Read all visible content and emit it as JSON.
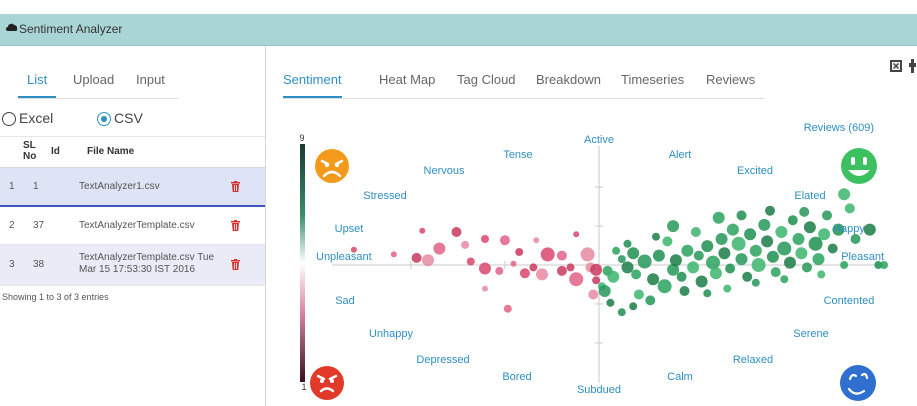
{
  "app": {
    "title": "Sentiment Analyzer"
  },
  "left_tabs": [
    "List",
    "Upload",
    "Input"
  ],
  "file_types": {
    "excel": "Excel",
    "csv": "CSV",
    "selected": "CSV"
  },
  "table": {
    "headers": {
      "sl": "SL No",
      "id": "Id",
      "file": "File Name"
    },
    "rows": [
      {
        "sl": "1",
        "id": "1",
        "file": "TextAnalyzer1.csv"
      },
      {
        "sl": "2",
        "id": "37",
        "file": "TextAnalyzerTemplate.csv"
      },
      {
        "sl": "3",
        "id": "38",
        "file_line1": "TextAnalyzerTemplate.csv Tue",
        "file_line2": "Mar 15 17:53:30 IST 2016"
      }
    ],
    "footer": "Showing 1 to 3 of 3 entries"
  },
  "right_tabs": [
    "Sentiment",
    "Heat Map",
    "Tag Cloud",
    "Breakdown",
    "Timeseries",
    "Reviews"
  ],
  "colors": {
    "accent": "#2f8fc2",
    "titlebar": "#a9d5d4",
    "positive": "#1f9a5a",
    "negative": "#d9466c",
    "trash": "#d9302c"
  },
  "chart_data": {
    "type": "scatter",
    "reviews_label": "Reviews (609)",
    "scale": {
      "max": "9",
      "min": "1"
    },
    "mood_labels": {
      "active": "Active",
      "tense": "Tense",
      "alert": "Alert",
      "nervous": "Nervous",
      "excited": "Excited",
      "stressed": "Stressed",
      "elated": "Elated",
      "upset": "Upset",
      "happy": "Happy",
      "unpleasant": "Unpleasant",
      "pleasant": "Pleasant",
      "sad": "Sad",
      "contented": "Contented",
      "unhappy": "Unhappy",
      "serene": "Serene",
      "depressed": "Depressed",
      "relaxed": "Relaxed",
      "bored": "Bored",
      "calm": "Calm",
      "subdued": "Subdued"
    },
    "x_range": [
      -1,
      1
    ],
    "y_range": [
      -1,
      1
    ],
    "points": [
      {
        "x": -0.86,
        "y": 0.13,
        "s": 3,
        "p": 0
      },
      {
        "x": -0.72,
        "y": 0.09,
        "s": 3,
        "p": 0
      },
      {
        "x": -0.64,
        "y": 0.06,
        "s": 5,
        "p": 0
      },
      {
        "x": -0.6,
        "y": 0.04,
        "s": 6,
        "p": 0
      },
      {
        "x": -0.62,
        "y": 0.29,
        "s": 3,
        "p": 0
      },
      {
        "x": -0.56,
        "y": 0.14,
        "s": 6,
        "p": 0
      },
      {
        "x": -0.5,
        "y": 0.28,
        "s": 5,
        "p": 0
      },
      {
        "x": -0.47,
        "y": 0.17,
        "s": 4,
        "p": 0
      },
      {
        "x": -0.4,
        "y": 0.22,
        "s": 4,
        "p": 0
      },
      {
        "x": -0.33,
        "y": 0.21,
        "s": 5,
        "p": 0
      },
      {
        "x": -0.28,
        "y": 0.11,
        "s": 4,
        "p": 0
      },
      {
        "x": -0.22,
        "y": 0.21,
        "s": 3,
        "p": 0
      },
      {
        "x": -0.18,
        "y": 0.09,
        "s": 7,
        "p": 0
      },
      {
        "x": -0.13,
        "y": 0.08,
        "s": 5,
        "p": 0
      },
      {
        "x": -0.1,
        "y": -0.02,
        "s": 4,
        "p": 0
      },
      {
        "x": -0.04,
        "y": 0.09,
        "s": 7,
        "p": 0
      },
      {
        "x": -0.4,
        "y": -0.03,
        "s": 6,
        "p": 0
      },
      {
        "x": -0.35,
        "y": -0.05,
        "s": 4,
        "p": 0
      },
      {
        "x": -0.23,
        "y": -0.02,
        "s": 4,
        "p": 0
      },
      {
        "x": -0.2,
        "y": -0.08,
        "s": 6,
        "p": 0
      },
      {
        "x": -0.26,
        "y": -0.07,
        "s": 5,
        "p": 0
      },
      {
        "x": -0.3,
        "y": 0.01,
        "s": 3,
        "p": 0
      },
      {
        "x": -0.13,
        "y": -0.05,
        "s": 5,
        "p": 0
      },
      {
        "x": -0.03,
        "y": -0.02,
        "s": 5,
        "p": 0
      },
      {
        "x": -0.45,
        "y": 0.03,
        "s": 4,
        "p": 0
      },
      {
        "x": -0.08,
        "y": -0.12,
        "s": 7,
        "p": 0
      },
      {
        "x": -0.01,
        "y": -0.13,
        "s": 4,
        "p": 0
      },
      {
        "x": -0.4,
        "y": -0.2,
        "s": 3,
        "p": 0
      },
      {
        "x": -0.08,
        "y": 0.26,
        "s": 3,
        "p": 0
      },
      {
        "x": -0.32,
        "y": -0.37,
        "s": 4,
        "p": 0
      },
      {
        "x": -0.01,
        "y": -0.04,
        "s": 6,
        "p": 0
      },
      {
        "x": -0.02,
        "y": -0.25,
        "s": 5,
        "p": 0
      },
      {
        "x": 0.01,
        "y": -0.18,
        "s": 4,
        "p": 1
      },
      {
        "x": 0.02,
        "y": -0.22,
        "s": 6,
        "p": 1
      },
      {
        "x": 0.04,
        "y": -0.32,
        "s": 4,
        "p": 1
      },
      {
        "x": 0.08,
        "y": -0.4,
        "s": 4,
        "p": 1
      },
      {
        "x": 0.03,
        "y": -0.05,
        "s": 5,
        "p": 1
      },
      {
        "x": 0.05,
        "y": -0.1,
        "s": 6,
        "p": 1
      },
      {
        "x": 0.08,
        "y": 0.05,
        "s": 4,
        "p": 1
      },
      {
        "x": 0.1,
        "y": -0.02,
        "s": 6,
        "p": 1
      },
      {
        "x": 0.12,
        "y": 0.1,
        "s": 6,
        "p": 1
      },
      {
        "x": 0.13,
        "y": -0.08,
        "s": 5,
        "p": 1
      },
      {
        "x": 0.14,
        "y": -0.25,
        "s": 5,
        "p": 1
      },
      {
        "x": 0.16,
        "y": 0.03,
        "s": 7,
        "p": 1
      },
      {
        "x": 0.19,
        "y": -0.12,
        "s": 6,
        "p": 1
      },
      {
        "x": 0.21,
        "y": 0.08,
        "s": 6,
        "p": 1
      },
      {
        "x": 0.23,
        "y": -0.18,
        "s": 7,
        "p": 1
      },
      {
        "x": 0.24,
        "y": 0.2,
        "s": 5,
        "p": 1
      },
      {
        "x": 0.26,
        "y": -0.04,
        "s": 6,
        "p": 1
      },
      {
        "x": 0.27,
        "y": 0.04,
        "s": 6,
        "p": 1
      },
      {
        "x": 0.29,
        "y": -0.1,
        "s": 5,
        "p": 1
      },
      {
        "x": 0.31,
        "y": 0.12,
        "s": 6,
        "p": 1
      },
      {
        "x": 0.33,
        "y": -0.02,
        "s": 6,
        "p": 1
      },
      {
        "x": 0.35,
        "y": 0.08,
        "s": 5,
        "p": 1
      },
      {
        "x": 0.36,
        "y": -0.14,
        "s": 6,
        "p": 1
      },
      {
        "x": 0.38,
        "y": 0.16,
        "s": 6,
        "p": 1
      },
      {
        "x": 0.4,
        "y": 0.02,
        "s": 7,
        "p": 1
      },
      {
        "x": 0.41,
        "y": -0.07,
        "s": 6,
        "p": 1
      },
      {
        "x": 0.43,
        "y": 0.22,
        "s": 6,
        "p": 1
      },
      {
        "x": 0.44,
        "y": 0.1,
        "s": 6,
        "p": 1
      },
      {
        "x": 0.46,
        "y": -0.03,
        "s": 5,
        "p": 1
      },
      {
        "x": 0.47,
        "y": 0.3,
        "s": 6,
        "p": 1
      },
      {
        "x": 0.49,
        "y": 0.18,
        "s": 7,
        "p": 1
      },
      {
        "x": 0.5,
        "y": 0.05,
        "s": 6,
        "p": 1
      },
      {
        "x": 0.52,
        "y": -0.1,
        "s": 5,
        "p": 1
      },
      {
        "x": 0.53,
        "y": 0.26,
        "s": 6,
        "p": 1
      },
      {
        "x": 0.55,
        "y": 0.12,
        "s": 6,
        "p": 1
      },
      {
        "x": 0.56,
        "y": 0.0,
        "s": 7,
        "p": 1
      },
      {
        "x": 0.58,
        "y": 0.34,
        "s": 6,
        "p": 1
      },
      {
        "x": 0.59,
        "y": 0.2,
        "s": 6,
        "p": 1
      },
      {
        "x": 0.61,
        "y": 0.07,
        "s": 6,
        "p": 1
      },
      {
        "x": 0.62,
        "y": -0.06,
        "s": 5,
        "p": 1
      },
      {
        "x": 0.64,
        "y": 0.28,
        "s": 6,
        "p": 1
      },
      {
        "x": 0.65,
        "y": 0.14,
        "s": 7,
        "p": 1
      },
      {
        "x": 0.67,
        "y": 0.02,
        "s": 6,
        "p": 1
      },
      {
        "x": 0.68,
        "y": 0.38,
        "s": 5,
        "p": 1
      },
      {
        "x": 0.7,
        "y": 0.22,
        "s": 6,
        "p": 1
      },
      {
        "x": 0.71,
        "y": 0.1,
        "s": 6,
        "p": 1
      },
      {
        "x": 0.73,
        "y": -0.02,
        "s": 5,
        "p": 1
      },
      {
        "x": 0.74,
        "y": 0.32,
        "s": 6,
        "p": 1
      },
      {
        "x": 0.76,
        "y": 0.18,
        "s": 7,
        "p": 1
      },
      {
        "x": 0.77,
        "y": 0.05,
        "s": 6,
        "p": 1
      },
      {
        "x": 0.79,
        "y": 0.26,
        "s": 6,
        "p": 1
      },
      {
        "x": 0.8,
        "y": 0.42,
        "s": 5,
        "p": 1
      },
      {
        "x": 0.82,
        "y": 0.14,
        "s": 5,
        "p": 1
      },
      {
        "x": 0.84,
        "y": 0.3,
        "s": 6,
        "p": 1
      },
      {
        "x": 0.86,
        "y": 0.0,
        "s": 4,
        "p": 1
      },
      {
        "x": 0.88,
        "y": 0.48,
        "s": 5,
        "p": 1
      },
      {
        "x": 0.9,
        "y": 0.22,
        "s": 5,
        "p": 1
      },
      {
        "x": 0.95,
        "y": 0.3,
        "s": 6,
        "p": 1
      },
      {
        "x": 0.98,
        "y": 0.0,
        "s": 4,
        "p": 1
      },
      {
        "x": 1.0,
        "y": 0.0,
        "s": 4,
        "p": 1
      },
      {
        "x": 0.86,
        "y": 0.6,
        "s": 6,
        "p": 1
      },
      {
        "x": 0.72,
        "y": 0.45,
        "s": 5,
        "p": 1
      },
      {
        "x": 0.6,
        "y": 0.46,
        "s": 5,
        "p": 1
      },
      {
        "x": 0.5,
        "y": 0.42,
        "s": 5,
        "p": 1
      },
      {
        "x": 0.42,
        "y": 0.4,
        "s": 6,
        "p": 1
      },
      {
        "x": 0.34,
        "y": 0.28,
        "s": 5,
        "p": 1
      },
      {
        "x": 0.26,
        "y": 0.33,
        "s": 6,
        "p": 1
      },
      {
        "x": 0.2,
        "y": 0.24,
        "s": 4,
        "p": 1
      },
      {
        "x": 0.1,
        "y": 0.18,
        "s": 4,
        "p": 1
      },
      {
        "x": 0.06,
        "y": 0.12,
        "s": 4,
        "p": 1
      },
      {
        "x": 0.45,
        "y": -0.2,
        "s": 4,
        "p": 1
      },
      {
        "x": 0.55,
        "y": -0.15,
        "s": 4,
        "p": 1
      },
      {
        "x": 0.3,
        "y": -0.22,
        "s": 5,
        "p": 1
      },
      {
        "x": 0.38,
        "y": -0.24,
        "s": 4,
        "p": 1
      },
      {
        "x": 0.65,
        "y": -0.12,
        "s": 4,
        "p": 1
      },
      {
        "x": 0.78,
        "y": -0.08,
        "s": 4,
        "p": 1
      },
      {
        "x": 0.18,
        "y": -0.3,
        "s": 5,
        "p": 1
      },
      {
        "x": 0.12,
        "y": -0.35,
        "s": 4,
        "p": 1
      }
    ]
  }
}
